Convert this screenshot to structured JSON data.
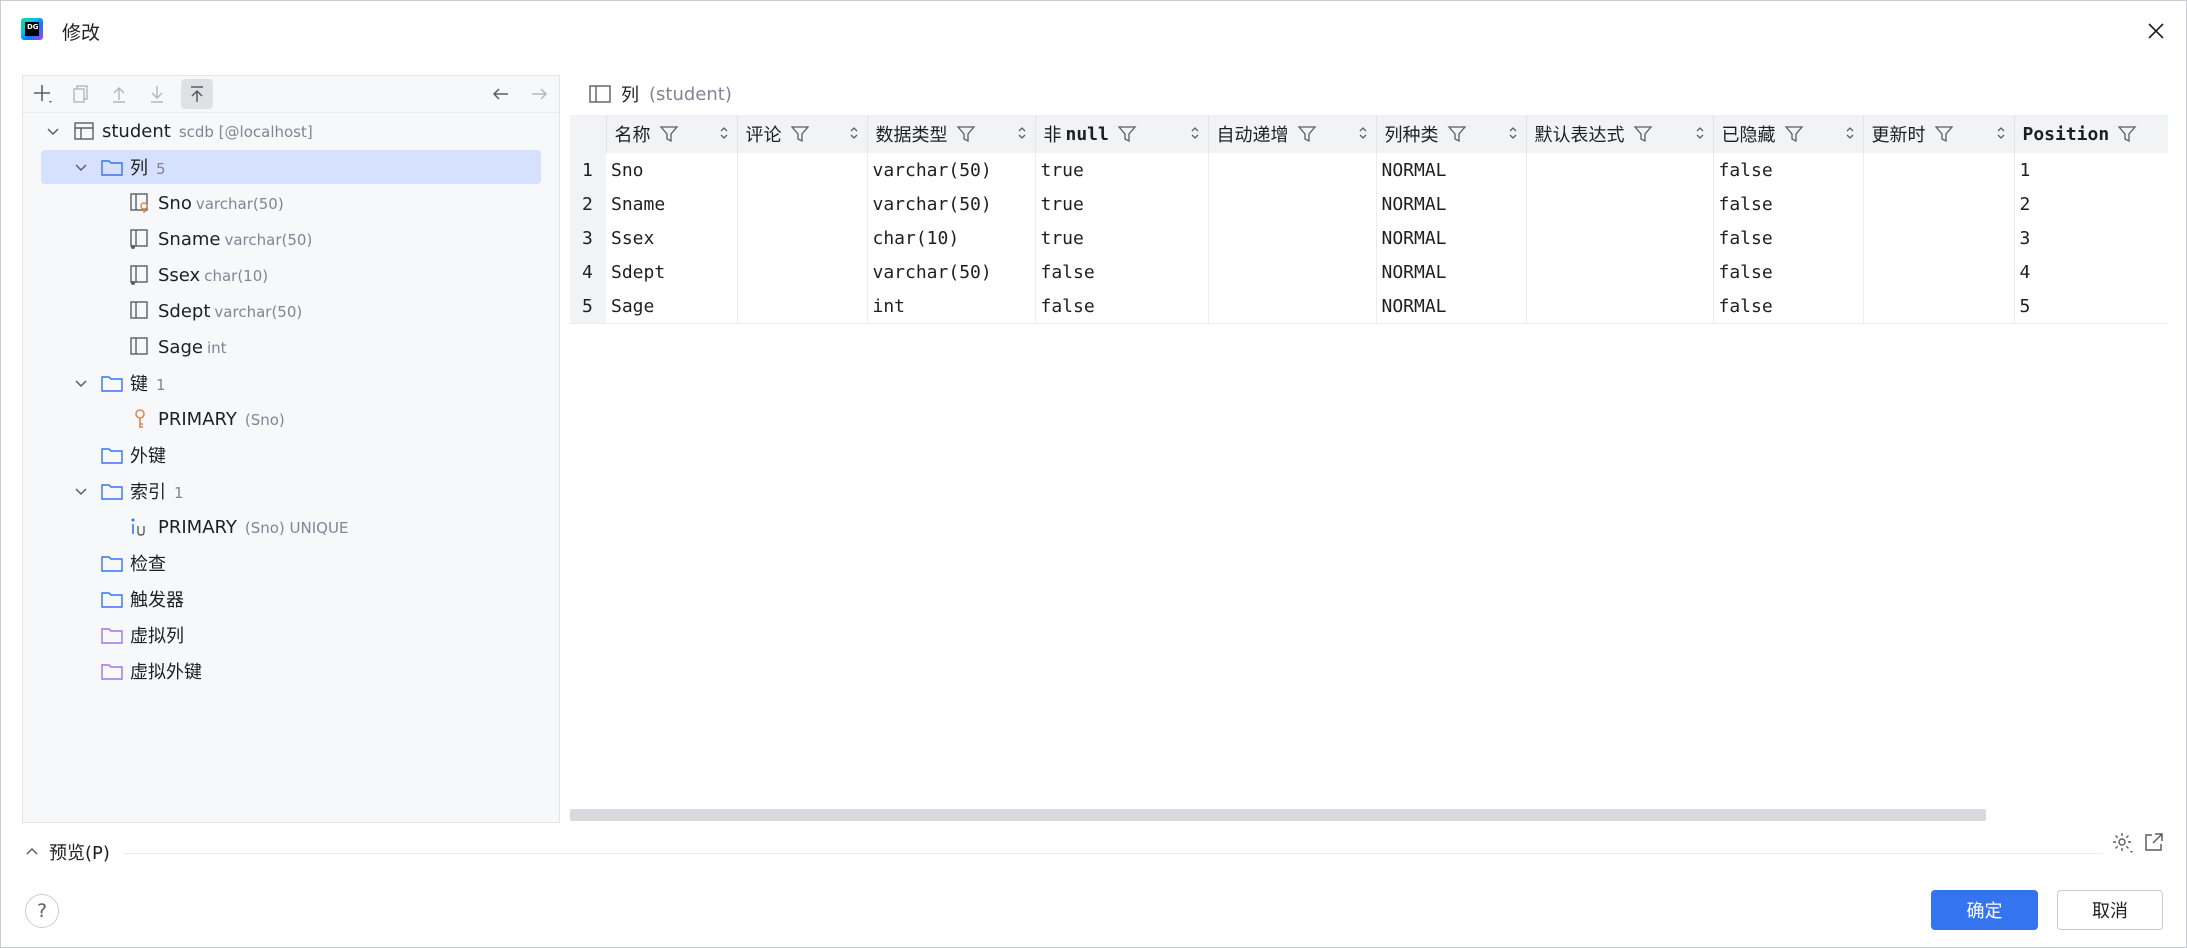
{
  "window": {
    "title": "修改"
  },
  "tree": {
    "root": {
      "label": "student",
      "secondary": "scdb [@localhost]"
    },
    "columns_folder": {
      "label": "列",
      "count": "5"
    },
    "columns": [
      {
        "label": "Sno",
        "type": "varchar(50)"
      },
      {
        "label": "Sname",
        "type": "varchar(50)"
      },
      {
        "label": "Ssex",
        "type": "char(10)"
      },
      {
        "label": "Sdept",
        "type": "varchar(50)"
      },
      {
        "label": "Sage",
        "type": "int"
      }
    ],
    "keys_folder": {
      "label": "键",
      "count": "1"
    },
    "key": {
      "label": "PRIMARY",
      "secondary": "(Sno)"
    },
    "fk_folder": {
      "label": "外键"
    },
    "index_folder": {
      "label": "索引",
      "count": "1"
    },
    "index": {
      "label": "PRIMARY",
      "secondary": "(Sno) UNIQUE"
    },
    "checks_folder": {
      "label": "检查"
    },
    "triggers_folder": {
      "label": "触发器"
    },
    "virtual_columns_folder": {
      "label": "虚拟列"
    },
    "virtual_fk_folder": {
      "label": "虚拟外键"
    }
  },
  "grid": {
    "caption": "列",
    "caption_secondary": "(student)",
    "headers": {
      "name": "名称",
      "comment": "评论",
      "datatype": "数据类型",
      "notnull_prefix": "非",
      "notnull_mono": "null",
      "autoinc": "自动递增",
      "kind": "列种类",
      "default": "默认表达式",
      "hidden": "已隐藏",
      "onupdate": "更新时",
      "position": "Position"
    },
    "rows": [
      {
        "n": "1",
        "name": "Sno",
        "comment": "",
        "type": "varchar(50)",
        "notnull": "true",
        "autoinc": "",
        "kind": "NORMAL",
        "default": "",
        "hidden": "false",
        "onupdate": "",
        "position": "1"
      },
      {
        "n": "2",
        "name": "Sname",
        "comment": "",
        "type": "varchar(50)",
        "notnull": "true",
        "autoinc": "",
        "kind": "NORMAL",
        "default": "",
        "hidden": "false",
        "onupdate": "",
        "position": "2"
      },
      {
        "n": "3",
        "name": "Ssex",
        "comment": "",
        "type": "char(10)",
        "notnull": "true",
        "autoinc": "",
        "kind": "NORMAL",
        "default": "",
        "hidden": "false",
        "onupdate": "",
        "position": "3"
      },
      {
        "n": "4",
        "name": "Sdept",
        "comment": "",
        "type": "varchar(50)",
        "notnull": "false",
        "autoinc": "",
        "kind": "NORMAL",
        "default": "",
        "hidden": "false",
        "onupdate": "",
        "position": "4"
      },
      {
        "n": "5",
        "name": "Sage",
        "comment": "",
        "type": "int",
        "notnull": "false",
        "autoinc": "",
        "kind": "NORMAL",
        "default": "",
        "hidden": "false",
        "onupdate": "",
        "position": "5"
      }
    ]
  },
  "footer": {
    "preview_label": "预览(P)",
    "help_label": "?",
    "ok_label": "确定",
    "cancel_label": "取消"
  },
  "colors": {
    "accent": "#3574f0",
    "selection": "#d5e1ff",
    "folder": "#3574f0",
    "virtual_folder": "#a571e6",
    "key": "#e08855"
  }
}
